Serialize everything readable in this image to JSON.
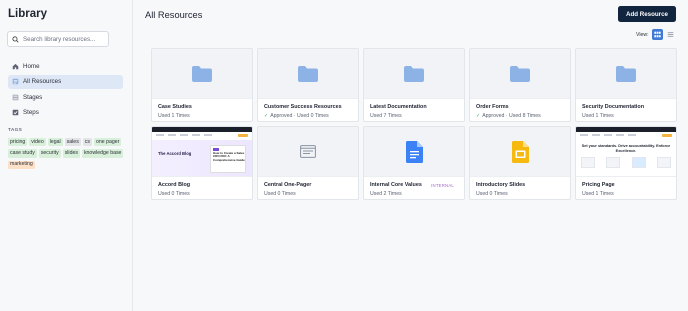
{
  "sidebar": {
    "title": "Library",
    "search": {
      "placeholder": "Search library resources..."
    },
    "nav": [
      {
        "label": "Home",
        "icon": "home-icon",
        "active": false
      },
      {
        "label": "All Resources",
        "icon": "all-resources-icon",
        "active": true
      },
      {
        "label": "Stages",
        "icon": "stages-icon",
        "active": false
      },
      {
        "label": "Steps",
        "icon": "steps-icon",
        "active": false
      }
    ],
    "tags_title": "TAGS",
    "tags": [
      {
        "label": "pricing",
        "color": "green"
      },
      {
        "label": "video",
        "color": "green"
      },
      {
        "label": "legal",
        "color": "green"
      },
      {
        "label": "sales",
        "color": "gray"
      },
      {
        "label": "cs",
        "color": "gray"
      },
      {
        "label": "one pager",
        "color": "green"
      },
      {
        "label": "case study",
        "color": "green"
      },
      {
        "label": "security",
        "color": "green"
      },
      {
        "label": "slides",
        "color": "green"
      },
      {
        "label": "knowledge base",
        "color": "green"
      },
      {
        "label": "marketing",
        "color": "orange"
      }
    ]
  },
  "main": {
    "title": "All Resources",
    "add_button": "Add Resource",
    "view_label": "View:",
    "accent": "#3f7ad6",
    "primary": "#12253f"
  },
  "cards": [
    {
      "title": "Case Studies",
      "meta": "Used 1 Times",
      "approved": false,
      "thumb": "folder"
    },
    {
      "title": "Customer Success Resources",
      "meta": "Approved · Used 0 Times",
      "approved": true,
      "thumb": "folder"
    },
    {
      "title": "Latest Documentation",
      "meta": "Used 7 Times",
      "approved": false,
      "thumb": "folder"
    },
    {
      "title": "Order Forms",
      "meta": "Approved · Used 8 Times",
      "approved": true,
      "thumb": "folder"
    },
    {
      "title": "Security Documentation",
      "meta": "Used 1 Times",
      "approved": false,
      "thumb": "folder"
    },
    {
      "title": "Accord Blog",
      "meta": "Used 0 Times",
      "approved": false,
      "thumb": "blog",
      "thumb_text": {
        "heading": "The Accord Blog",
        "post": "How to Create a Sales CRO ROI: A Comprehensive Guide"
      }
    },
    {
      "title": "Central One-Pager",
      "meta": "Used 0 Times",
      "approved": false,
      "thumb": "web-page"
    },
    {
      "title": "Internal Core Values",
      "meta": "Used 2 Times",
      "approved": false,
      "thumb": "google-doc",
      "badge": "INTERNAL"
    },
    {
      "title": "Introductory Slides",
      "meta": "Used 0 Times",
      "approved": false,
      "thumb": "google-slides"
    },
    {
      "title": "Pricing Page",
      "meta": "Used 1 Times",
      "approved": false,
      "thumb": "pricing",
      "thumb_text": {
        "heading": "Set your standards. Drive accountability. Enforce Excellence."
      }
    }
  ]
}
